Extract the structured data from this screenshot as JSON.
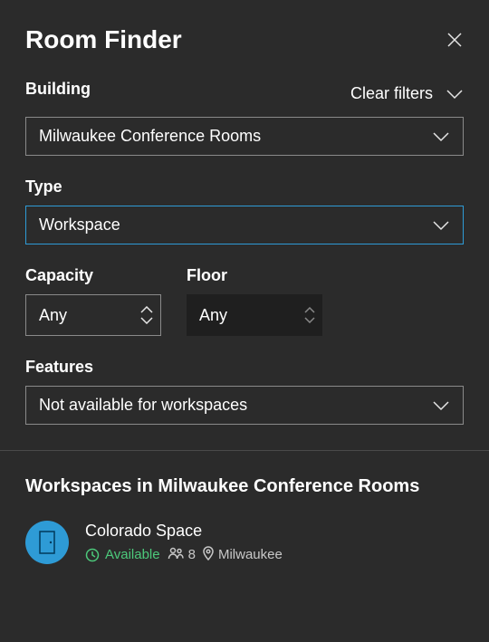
{
  "title": "Room Finder",
  "filters": {
    "building_label": "Building",
    "clear_label": "Clear filters",
    "building_value": "Milwaukee Conference Rooms",
    "type_label": "Type",
    "type_value": "Workspace",
    "capacity_label": "Capacity",
    "capacity_value": "Any",
    "floor_label": "Floor",
    "floor_value": "Any",
    "features_label": "Features",
    "features_value": "Not available for workspaces"
  },
  "results": {
    "heading": "Workspaces in Milwaukee Conference Rooms",
    "item": {
      "name": "Colorado Space",
      "status": "Available",
      "capacity": "8",
      "location": "Milwaukee"
    }
  }
}
